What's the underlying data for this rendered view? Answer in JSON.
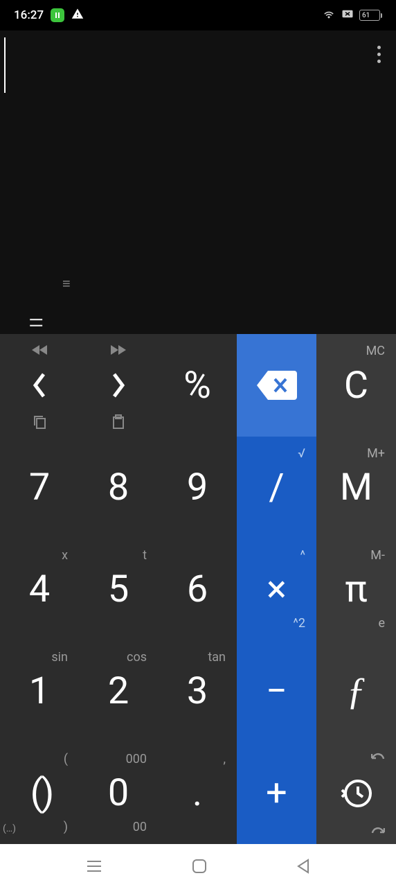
{
  "status": {
    "time": "16:27",
    "battery": "61"
  },
  "display": {
    "hamburger_small": "≡",
    "equals": "="
  },
  "keys": {
    "r0c0": {
      "main_icon": "chevron-left",
      "sup_tc_icon": "rewind",
      "sup_bc_icon": "copy"
    },
    "r0c1": {
      "main_icon": "chevron-right",
      "sup_tc_icon": "forward",
      "sup_bc_icon": "clipboard"
    },
    "r0c2": {
      "main": "%"
    },
    "r0c3": {
      "main_icon": "backspace"
    },
    "r0c4": {
      "main": "C",
      "sup_tr": "MC"
    },
    "r1c0": {
      "main": "7"
    },
    "r1c1": {
      "main": "8"
    },
    "r1c2": {
      "main": "9"
    },
    "r1c3": {
      "main": "/",
      "sup_tr": "√"
    },
    "r1c4": {
      "main": "M",
      "sup_tr": "M+"
    },
    "r2c0": {
      "main": "4",
      "sup_tr": "x"
    },
    "r2c1": {
      "main": "5",
      "sup_tr": "t"
    },
    "r2c2": {
      "main": "6"
    },
    "r2c3": {
      "main": "×",
      "sup_tr": "^",
      "sup_br": "^2"
    },
    "r2c4": {
      "main": "π",
      "sup_tr": "M-",
      "sup_br": "e"
    },
    "r3c0": {
      "main": "1",
      "sup_tr": "sin"
    },
    "r3c1": {
      "main": "2",
      "sup_tr": "cos"
    },
    "r3c2": {
      "main": "3",
      "sup_tr": "tan"
    },
    "r3c3": {
      "main": "−"
    },
    "r3c4": {
      "main": "ƒ"
    },
    "r4c0": {
      "main": "( )",
      "sup_tr": "(",
      "sup_br": ")",
      "sup_bl": "(…)"
    },
    "r4c1": {
      "main": "0",
      "sup_tr": "000",
      "sup_br": "00"
    },
    "r4c2": {
      "main": ".",
      "sup_tr": ","
    },
    "r4c3": {
      "main": "+"
    },
    "r4c4": {
      "main_icon": "history",
      "sup_tr_icon": "undo",
      "sup_br_icon": "redo"
    }
  }
}
